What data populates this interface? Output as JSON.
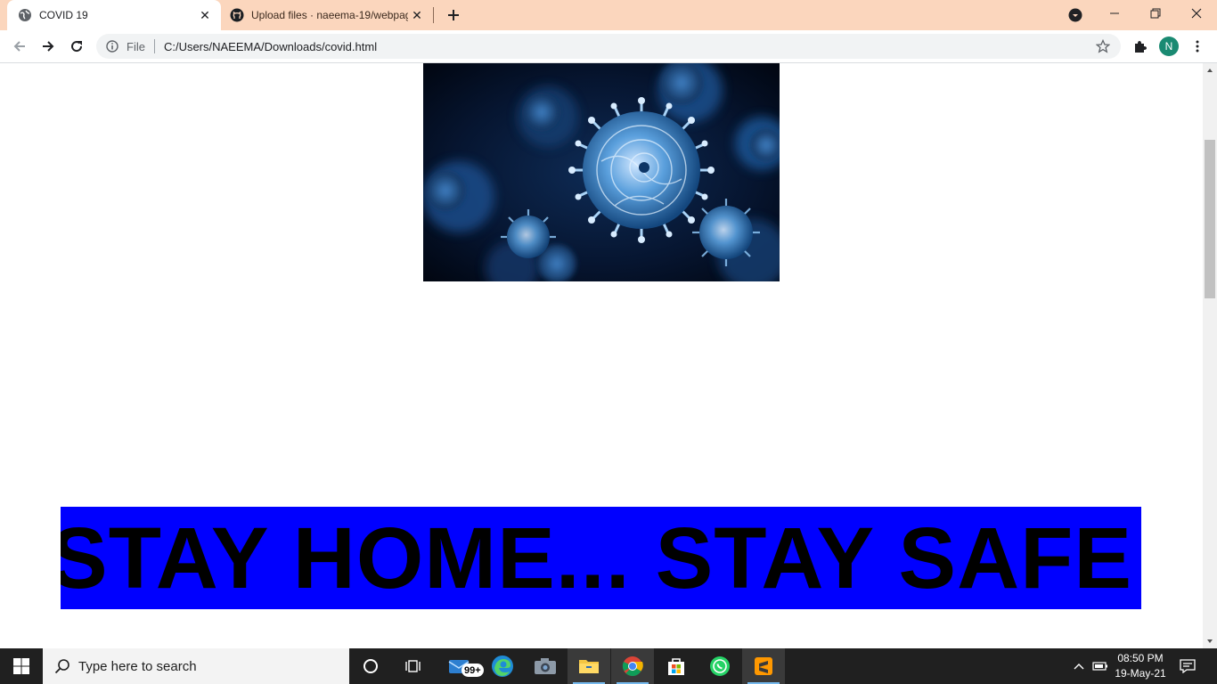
{
  "browser": {
    "tabs": [
      {
        "title": "COVID 19",
        "active": true,
        "icon": "globe-icon"
      },
      {
        "title": "Upload files · naeema-19/webpage",
        "active": false,
        "icon": "github-icon"
      }
    ],
    "omnibox": {
      "scheme_chip": "File",
      "url": "C:/Users/NAEEMA/Downloads/covid.html"
    },
    "profile_initial": "N",
    "colors": {
      "tabstrip": "#fbd6bd",
      "profile": "#1a8a72"
    }
  },
  "page": {
    "image_alt": "coronavirus-illustration",
    "banner_text": "STAY HOME... STAY SAFE",
    "colors": {
      "banner_background": "#0000ff",
      "banner_text": "#000000"
    }
  },
  "taskbar": {
    "search_placeholder": "Type here to search",
    "mail_badge": "99+",
    "apps": [
      "cortana-icon",
      "task-view-icon",
      "mail-icon",
      "edge-icon",
      "camera-icon",
      "file-explorer-icon",
      "chrome-icon",
      "store-icon",
      "whatsapp-icon",
      "sublime-text-icon"
    ],
    "active_apps": [
      "file-explorer-icon",
      "chrome-icon",
      "sublime-text-icon"
    ],
    "clock": {
      "time": "08:50 PM",
      "date": "19-May-21"
    }
  }
}
